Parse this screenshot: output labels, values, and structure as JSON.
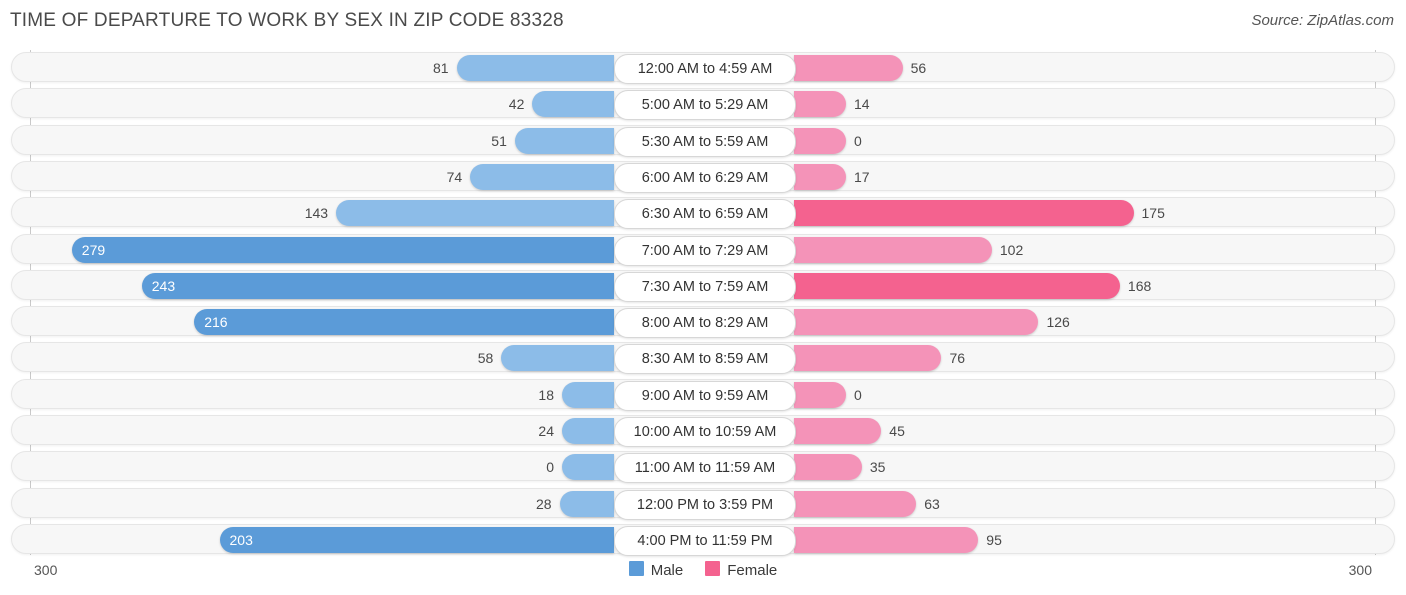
{
  "header": {
    "title": "TIME OF DEPARTURE TO WORK BY SEX IN ZIP CODE 83328",
    "source": "Source: ZipAtlas.com"
  },
  "legend": {
    "items": [
      {
        "label": "Male",
        "color": "#5b9bd8"
      },
      {
        "label": "Female",
        "color": "#f4628f"
      }
    ]
  },
  "axis": {
    "left_label": "300",
    "right_label": "300"
  },
  "chart_data": {
    "type": "bar",
    "subtype": "diverging-bidirectional-bar",
    "title": "TIME OF DEPARTURE TO WORK BY SEX IN ZIP CODE 83328",
    "source": "Source: ZipAtlas.com",
    "xlabel": "",
    "ylabel": "",
    "xlim": [
      -300,
      300
    ],
    "axis_tick_labels": [
      "300",
      "300"
    ],
    "grid": false,
    "legend_position": "bottom-center",
    "categories": [
      "12:00 AM to 4:59 AM",
      "5:00 AM to 5:29 AM",
      "5:30 AM to 5:59 AM",
      "6:00 AM to 6:29 AM",
      "6:30 AM to 6:59 AM",
      "7:00 AM to 7:29 AM",
      "7:30 AM to 7:59 AM",
      "8:00 AM to 8:29 AM",
      "8:30 AM to 8:59 AM",
      "9:00 AM to 9:59 AM",
      "10:00 AM to 10:59 AM",
      "11:00 AM to 11:59 AM",
      "12:00 PM to 3:59 PM",
      "4:00 PM to 11:59 PM"
    ],
    "series": [
      {
        "name": "Male",
        "color": "#5b9bd8",
        "direction": "left",
        "values": [
          81,
          42,
          51,
          74,
          143,
          279,
          243,
          216,
          58,
          18,
          24,
          0,
          28,
          203
        ]
      },
      {
        "name": "Female",
        "color": "#f4628f",
        "direction": "right",
        "values": [
          56,
          14,
          0,
          17,
          175,
          102,
          168,
          126,
          76,
          0,
          45,
          35,
          63,
          95
        ]
      }
    ]
  },
  "rows": [
    {
      "category": "12:00 AM to 4:59 AM",
      "male": "81",
      "female": "56"
    },
    {
      "category": "5:00 AM to 5:29 AM",
      "male": "42",
      "female": "14"
    },
    {
      "category": "5:30 AM to 5:59 AM",
      "male": "51",
      "female": "0"
    },
    {
      "category": "6:00 AM to 6:29 AM",
      "male": "74",
      "female": "17"
    },
    {
      "category": "6:30 AM to 6:59 AM",
      "male": "143",
      "female": "175"
    },
    {
      "category": "7:00 AM to 7:29 AM",
      "male": "279",
      "female": "102"
    },
    {
      "category": "7:30 AM to 7:59 AM",
      "male": "243",
      "female": "168"
    },
    {
      "category": "8:00 AM to 8:29 AM",
      "male": "216",
      "female": "126"
    },
    {
      "category": "8:30 AM to 8:59 AM",
      "male": "58",
      "female": "76"
    },
    {
      "category": "9:00 AM to 9:59 AM",
      "male": "18",
      "female": "0"
    },
    {
      "category": "10:00 AM to 10:59 AM",
      "male": "24",
      "female": "45"
    },
    {
      "category": "11:00 AM to 11:59 AM",
      "male": "0",
      "female": "35"
    },
    {
      "category": "12:00 PM to 3:59 PM",
      "male": "28",
      "female": "63"
    },
    {
      "category": "4:00 PM to 11:59 PM",
      "male": "203",
      "female": "95"
    }
  ]
}
